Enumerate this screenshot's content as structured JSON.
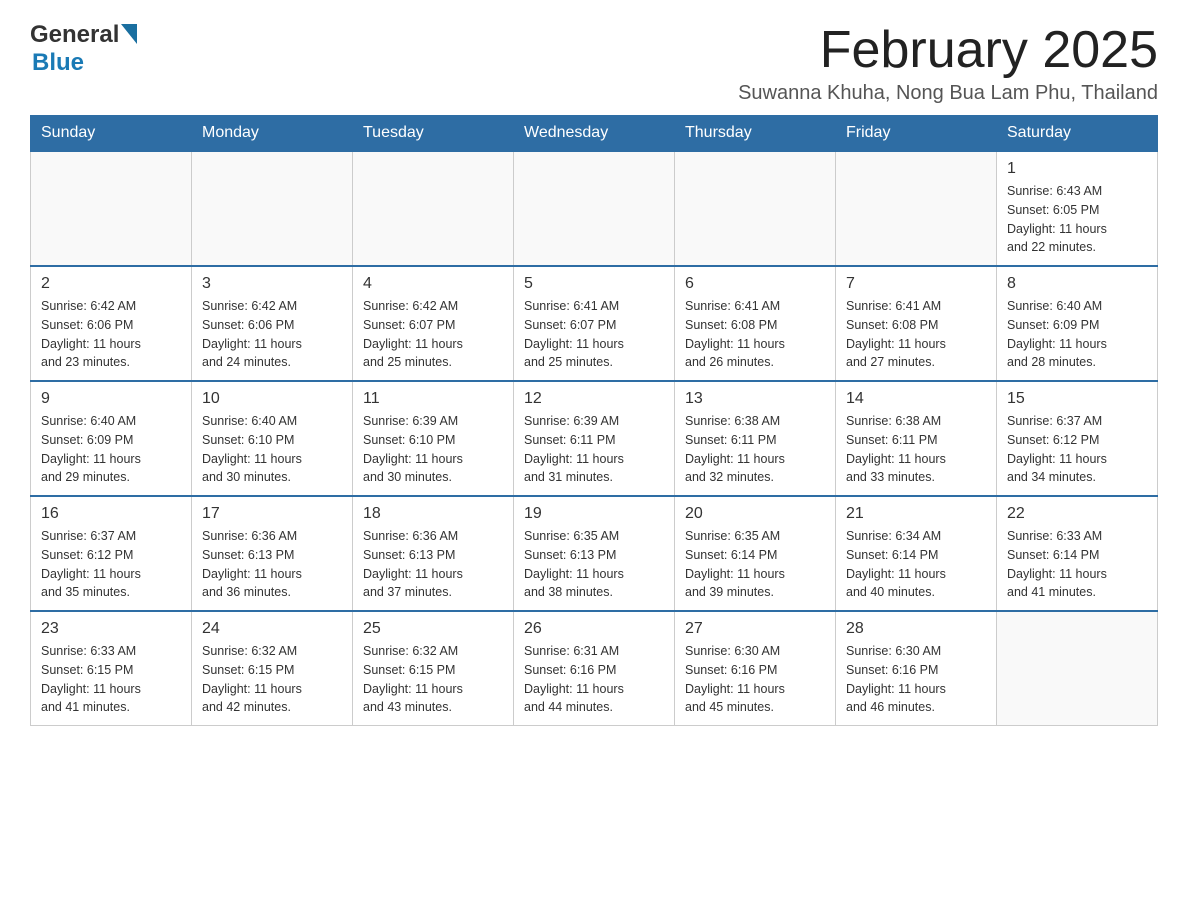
{
  "header": {
    "logo": {
      "general": "General",
      "blue": "Blue"
    },
    "title": "February 2025",
    "location": "Suwanna Khuha, Nong Bua Lam Phu, Thailand"
  },
  "calendar": {
    "days": [
      "Sunday",
      "Monday",
      "Tuesday",
      "Wednesday",
      "Thursday",
      "Friday",
      "Saturday"
    ],
    "weeks": [
      {
        "cells": [
          {
            "day": "",
            "info": ""
          },
          {
            "day": "",
            "info": ""
          },
          {
            "day": "",
            "info": ""
          },
          {
            "day": "",
            "info": ""
          },
          {
            "day": "",
            "info": ""
          },
          {
            "day": "",
            "info": ""
          },
          {
            "day": "1",
            "info": "Sunrise: 6:43 AM\nSunset: 6:05 PM\nDaylight: 11 hours\nand 22 minutes."
          }
        ]
      },
      {
        "cells": [
          {
            "day": "2",
            "info": "Sunrise: 6:42 AM\nSunset: 6:06 PM\nDaylight: 11 hours\nand 23 minutes."
          },
          {
            "day": "3",
            "info": "Sunrise: 6:42 AM\nSunset: 6:06 PM\nDaylight: 11 hours\nand 24 minutes."
          },
          {
            "day": "4",
            "info": "Sunrise: 6:42 AM\nSunset: 6:07 PM\nDaylight: 11 hours\nand 25 minutes."
          },
          {
            "day": "5",
            "info": "Sunrise: 6:41 AM\nSunset: 6:07 PM\nDaylight: 11 hours\nand 25 minutes."
          },
          {
            "day": "6",
            "info": "Sunrise: 6:41 AM\nSunset: 6:08 PM\nDaylight: 11 hours\nand 26 minutes."
          },
          {
            "day": "7",
            "info": "Sunrise: 6:41 AM\nSunset: 6:08 PM\nDaylight: 11 hours\nand 27 minutes."
          },
          {
            "day": "8",
            "info": "Sunrise: 6:40 AM\nSunset: 6:09 PM\nDaylight: 11 hours\nand 28 minutes."
          }
        ]
      },
      {
        "cells": [
          {
            "day": "9",
            "info": "Sunrise: 6:40 AM\nSunset: 6:09 PM\nDaylight: 11 hours\nand 29 minutes."
          },
          {
            "day": "10",
            "info": "Sunrise: 6:40 AM\nSunset: 6:10 PM\nDaylight: 11 hours\nand 30 minutes."
          },
          {
            "day": "11",
            "info": "Sunrise: 6:39 AM\nSunset: 6:10 PM\nDaylight: 11 hours\nand 30 minutes."
          },
          {
            "day": "12",
            "info": "Sunrise: 6:39 AM\nSunset: 6:11 PM\nDaylight: 11 hours\nand 31 minutes."
          },
          {
            "day": "13",
            "info": "Sunrise: 6:38 AM\nSunset: 6:11 PM\nDaylight: 11 hours\nand 32 minutes."
          },
          {
            "day": "14",
            "info": "Sunrise: 6:38 AM\nSunset: 6:11 PM\nDaylight: 11 hours\nand 33 minutes."
          },
          {
            "day": "15",
            "info": "Sunrise: 6:37 AM\nSunset: 6:12 PM\nDaylight: 11 hours\nand 34 minutes."
          }
        ]
      },
      {
        "cells": [
          {
            "day": "16",
            "info": "Sunrise: 6:37 AM\nSunset: 6:12 PM\nDaylight: 11 hours\nand 35 minutes."
          },
          {
            "day": "17",
            "info": "Sunrise: 6:36 AM\nSunset: 6:13 PM\nDaylight: 11 hours\nand 36 minutes."
          },
          {
            "day": "18",
            "info": "Sunrise: 6:36 AM\nSunset: 6:13 PM\nDaylight: 11 hours\nand 37 minutes."
          },
          {
            "day": "19",
            "info": "Sunrise: 6:35 AM\nSunset: 6:13 PM\nDaylight: 11 hours\nand 38 minutes."
          },
          {
            "day": "20",
            "info": "Sunrise: 6:35 AM\nSunset: 6:14 PM\nDaylight: 11 hours\nand 39 minutes."
          },
          {
            "day": "21",
            "info": "Sunrise: 6:34 AM\nSunset: 6:14 PM\nDaylight: 11 hours\nand 40 minutes."
          },
          {
            "day": "22",
            "info": "Sunrise: 6:33 AM\nSunset: 6:14 PM\nDaylight: 11 hours\nand 41 minutes."
          }
        ]
      },
      {
        "cells": [
          {
            "day": "23",
            "info": "Sunrise: 6:33 AM\nSunset: 6:15 PM\nDaylight: 11 hours\nand 41 minutes."
          },
          {
            "day": "24",
            "info": "Sunrise: 6:32 AM\nSunset: 6:15 PM\nDaylight: 11 hours\nand 42 minutes."
          },
          {
            "day": "25",
            "info": "Sunrise: 6:32 AM\nSunset: 6:15 PM\nDaylight: 11 hours\nand 43 minutes."
          },
          {
            "day": "26",
            "info": "Sunrise: 6:31 AM\nSunset: 6:16 PM\nDaylight: 11 hours\nand 44 minutes."
          },
          {
            "day": "27",
            "info": "Sunrise: 6:30 AM\nSunset: 6:16 PM\nDaylight: 11 hours\nand 45 minutes."
          },
          {
            "day": "28",
            "info": "Sunrise: 6:30 AM\nSunset: 6:16 PM\nDaylight: 11 hours\nand 46 minutes."
          },
          {
            "day": "",
            "info": ""
          }
        ]
      }
    ]
  }
}
